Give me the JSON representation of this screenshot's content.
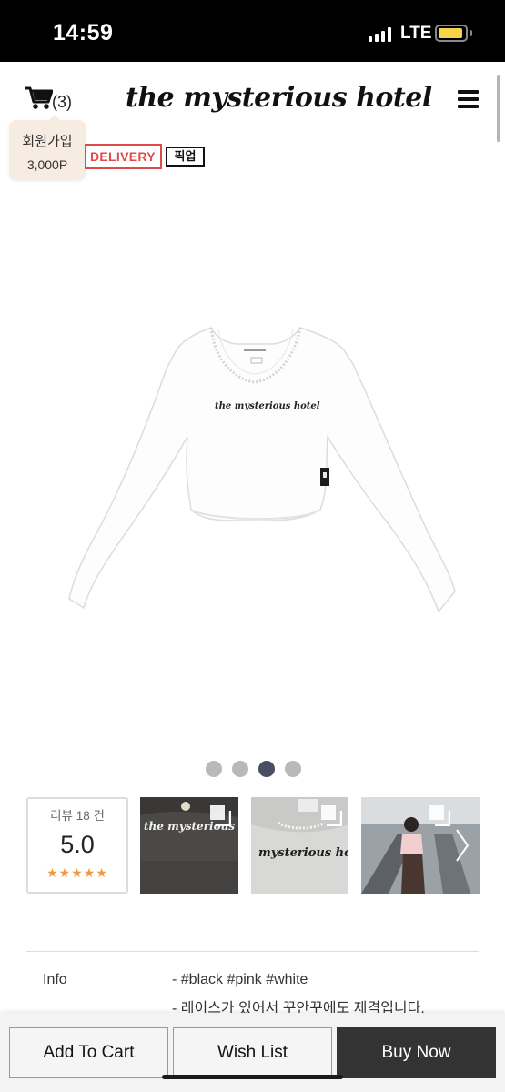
{
  "status_bar": {
    "time": "14:59",
    "network": "LTE",
    "icons": [
      "signal-icon",
      "battery-icon"
    ]
  },
  "header": {
    "cart_count": "(3)",
    "brand": "the mysterious hotel",
    "icons": [
      "cart-icon",
      "menu-icon"
    ]
  },
  "signup_tooltip": {
    "title": "회원가입",
    "points": "3,000P"
  },
  "badges": {
    "delivery": "DELIVERY",
    "pickup": "픽업"
  },
  "product": {
    "print_text": "the mysterious hotel",
    "image_count": 4,
    "active_image": 3
  },
  "review": {
    "count_label": "리뷰 18 건",
    "score": "5.0",
    "stars": "★★★★★",
    "star_color": "#f09a3e"
  },
  "thumbnails": [
    {
      "caption": "the mysterious hotel"
    },
    {
      "caption": "mysterious hotel"
    },
    {
      "caption": ""
    }
  ],
  "info": {
    "label": "Info",
    "line_1": "- #black #pink #white",
    "line_2": "- 레이스가 있어서 꾸안꾸에도 제격입니다."
  },
  "actions": {
    "add_to_cart": "Add To Cart",
    "wish_list": "Wish List",
    "buy_now": "Buy Now"
  },
  "colors": {
    "delivery_badge": "#e04a4a",
    "buy_button": "#333333",
    "tooltip_bg": "#f7ece2",
    "active_dot": "#4a4e63"
  }
}
